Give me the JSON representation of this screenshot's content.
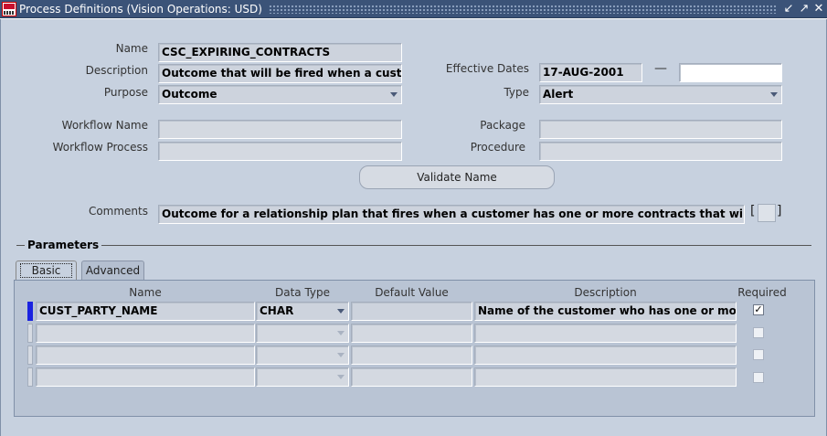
{
  "window": {
    "title": "Process Definitions (Vision Operations: USD)",
    "controls": [
      "minimize-icon",
      "restore-icon",
      "close-icon"
    ]
  },
  "header": {
    "name_label": "Name",
    "name_value": "CSC_EXPIRING_CONTRACTS",
    "description_label": "Description",
    "description_value": "Outcome that will be fired when a customer has one or more contracts that will expire",
    "purpose_label": "Purpose",
    "purpose_value": "Outcome",
    "effective_dates_label": "Effective Dates",
    "effective_from": "17-AUG-2001",
    "effective_dash": "—",
    "effective_to": "",
    "type_label": "Type",
    "type_value": "Alert",
    "workflow_name_label": "Workflow Name",
    "workflow_name_value": "",
    "workflow_process_label": "Workflow Process",
    "workflow_process_value": "",
    "package_label": "Package",
    "package_value": "",
    "procedure_label": "Procedure",
    "procedure_value": "",
    "validate_button": "Validate Name",
    "comments_label": "Comments",
    "comments_value": "Outcome for a relationship plan that fires when a customer has one or more contracts that will expire"
  },
  "parameters": {
    "group_title": "Parameters",
    "tabs": [
      {
        "label": "Basic",
        "active": true
      },
      {
        "label": "Advanced",
        "active": false
      }
    ],
    "columns": [
      "Name",
      "Data Type",
      "Default Value",
      "Description",
      "Required"
    ],
    "rows": [
      {
        "name": "CUST_PARTY_NAME",
        "data_type": "CHAR",
        "default_value": "",
        "description": "Name of the customer who has one or more contracts",
        "required": true
      },
      {
        "name": "",
        "data_type": "",
        "default_value": "",
        "description": "",
        "required": false
      },
      {
        "name": "",
        "data_type": "",
        "default_value": "",
        "description": "",
        "required": false
      },
      {
        "name": "",
        "data_type": "",
        "default_value": "",
        "description": "",
        "required": false
      }
    ]
  },
  "colors": {
    "titlebar": "#3b5378",
    "form_background": "#c7d1df",
    "current_record": "#1a22e0"
  }
}
